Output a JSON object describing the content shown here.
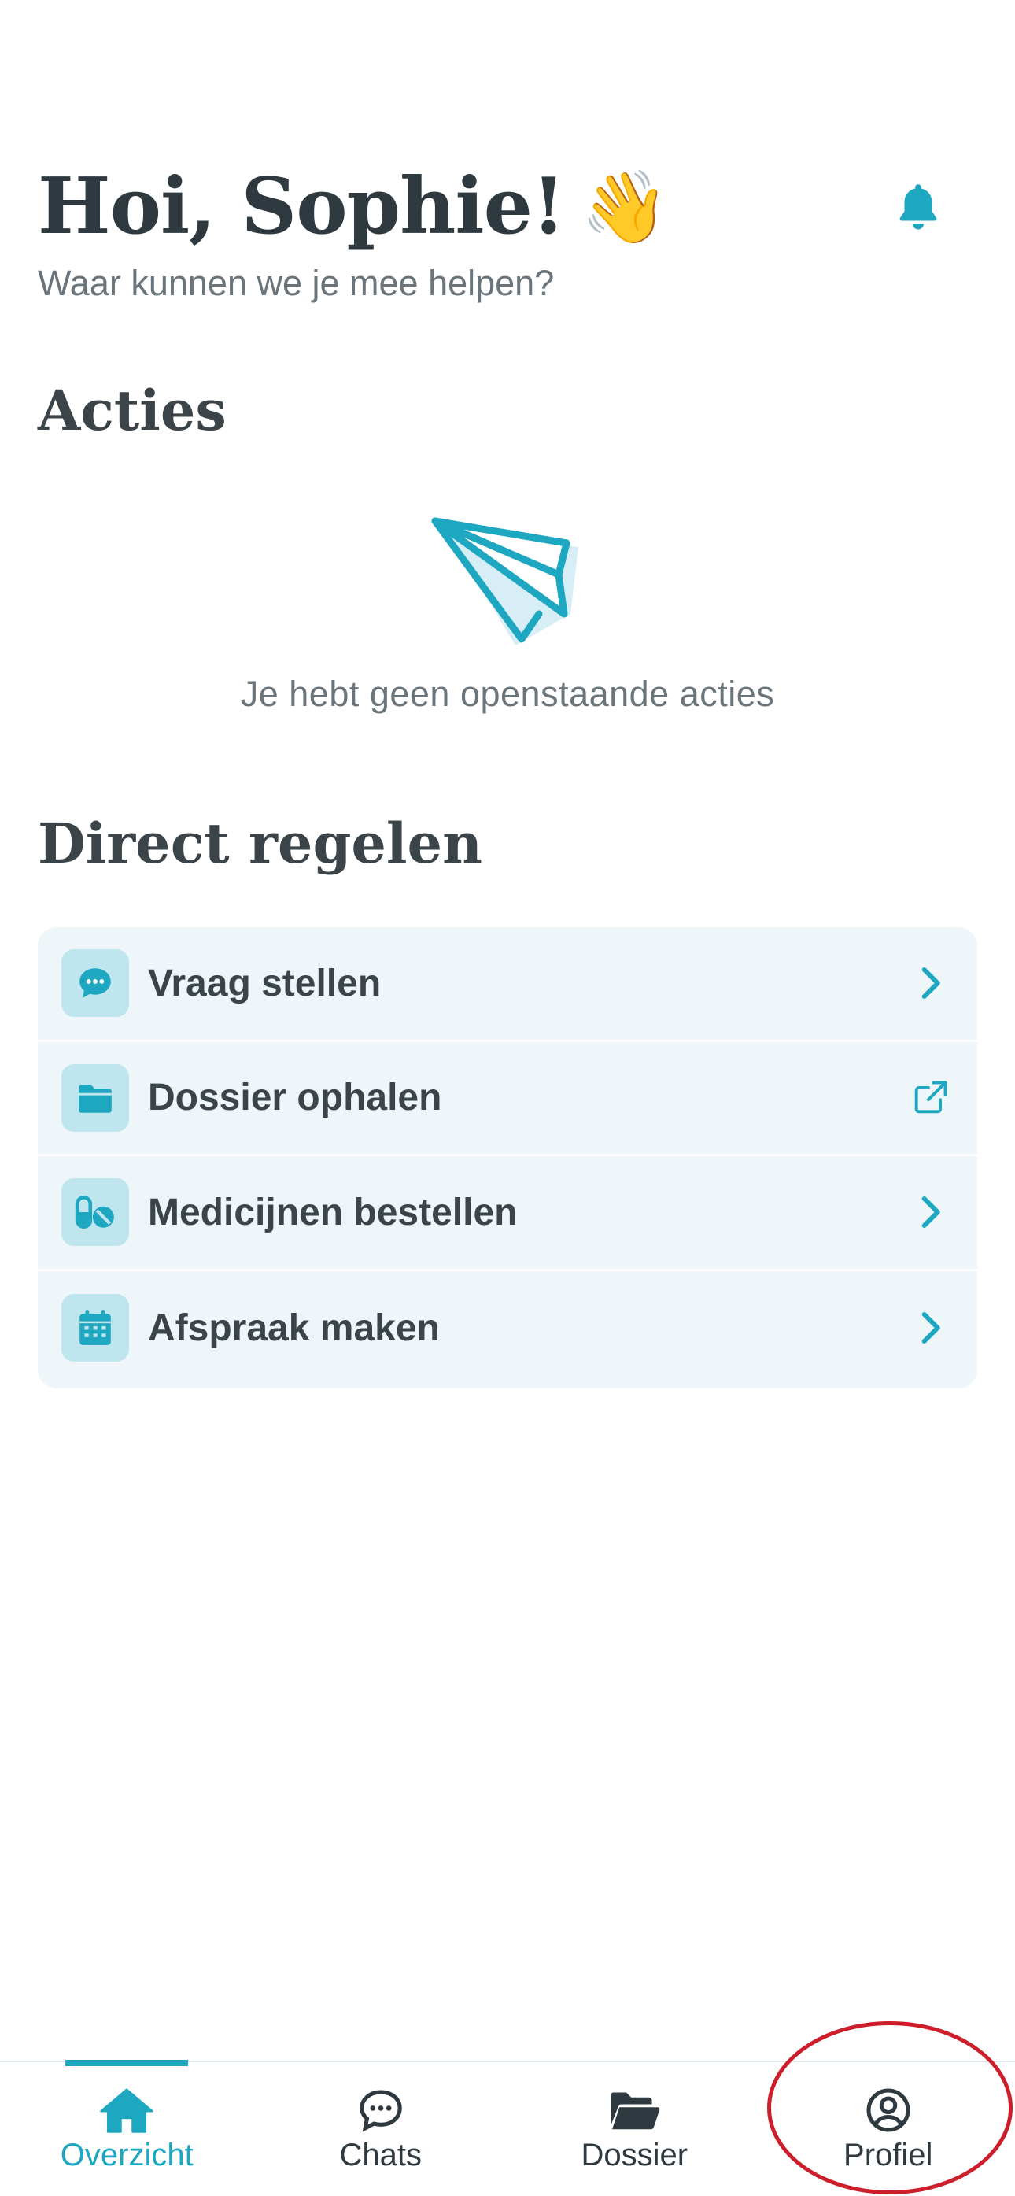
{
  "header": {
    "greeting": "Hoi, Sophie!",
    "wave_emoji": "👋",
    "subtitle": "Waar kunnen we je mee helpen?",
    "notification_icon": "bell-icon"
  },
  "actions": {
    "title": "Acties",
    "empty_icon": "paper-plane-icon",
    "empty_text": "Je hebt geen openstaande acties"
  },
  "direct": {
    "title": "Direct regelen",
    "items": [
      {
        "label": "Vraag stellen",
        "icon": "chat-bubble-icon",
        "end_icon": "chevron-right-icon"
      },
      {
        "label": "Dossier ophalen",
        "icon": "folder-icon",
        "end_icon": "external-link-icon"
      },
      {
        "label": "Medicijnen bestellen",
        "icon": "pills-icon",
        "end_icon": "chevron-right-icon"
      },
      {
        "label": "Afspraak maken",
        "icon": "calendar-icon",
        "end_icon": "chevron-right-icon"
      }
    ]
  },
  "tabbar": {
    "tabs": [
      {
        "label": "Overzicht",
        "icon": "home-icon",
        "active": true
      },
      {
        "label": "Chats",
        "icon": "chat-icon",
        "active": false
      },
      {
        "label": "Dossier",
        "icon": "folder-open-icon",
        "active": false
      },
      {
        "label": "Profiel",
        "icon": "user-circle-icon",
        "active": false
      }
    ]
  },
  "colors": {
    "accent": "#1da7c1",
    "text": "#3b4449",
    "card_bg": "#eef6f9",
    "icon_bg": "#bfe5ef",
    "highlight": "#cc1f2b"
  }
}
